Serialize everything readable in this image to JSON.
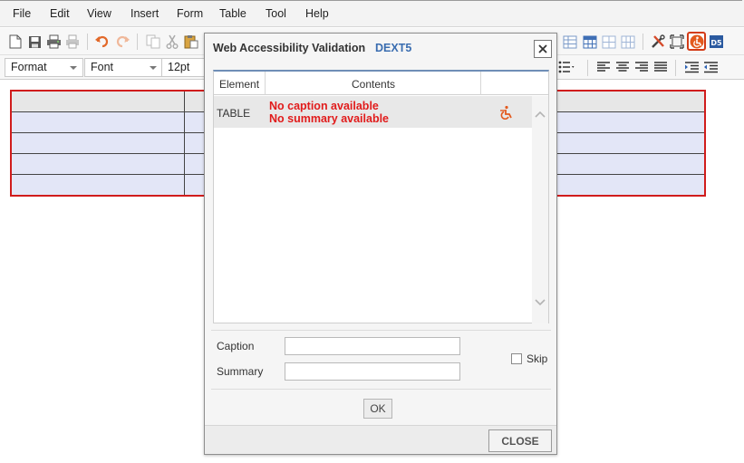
{
  "menu": [
    "File",
    "Edit",
    "View",
    "Insert",
    "Form",
    "Table",
    "Tool",
    "Help"
  ],
  "toolbar2": {
    "format_label": "Format",
    "font_label": "Font",
    "size_label": "12pt"
  },
  "icons": [
    "new-doc-icon",
    "save-icon",
    "print-icon",
    "print-preview-icon",
    "undo-icon",
    "redo-icon",
    "copy-icon",
    "cut-icon",
    "paste-icon",
    "table-icon",
    "table-grid-icon",
    "table-cells-icon",
    "table-cols-icon",
    "tools-icon",
    "fullscreen-icon",
    "accessibility-icon",
    "dext5-icon",
    "bullet-list-icon",
    "align-left-icon",
    "align-center-icon",
    "align-right-icon",
    "align-justify-icon",
    "indent-icon",
    "outdent-icon"
  ],
  "colors": {
    "accent_red": "#d01c1c",
    "error_text": "#e11b1b",
    "brand_blue": "#3a6db0",
    "table_fill": "#e3e6f7",
    "accessibility_orange": "#e35a1e"
  },
  "dialog": {
    "title": "Web Accessibility Validation",
    "brand": "DEXT5",
    "columns": [
      "Element",
      "Contents"
    ],
    "rows": [
      {
        "element": "TABLE",
        "messages": [
          "No caption available",
          "No summary available"
        ],
        "icon": "accessibility-icon"
      }
    ],
    "caption_label": "Caption",
    "caption_value": "",
    "summary_label": "Summary",
    "summary_value": "",
    "skip_label": "Skip",
    "skip_checked": false,
    "ok_label": "OK",
    "close_label": "CLOSE"
  }
}
